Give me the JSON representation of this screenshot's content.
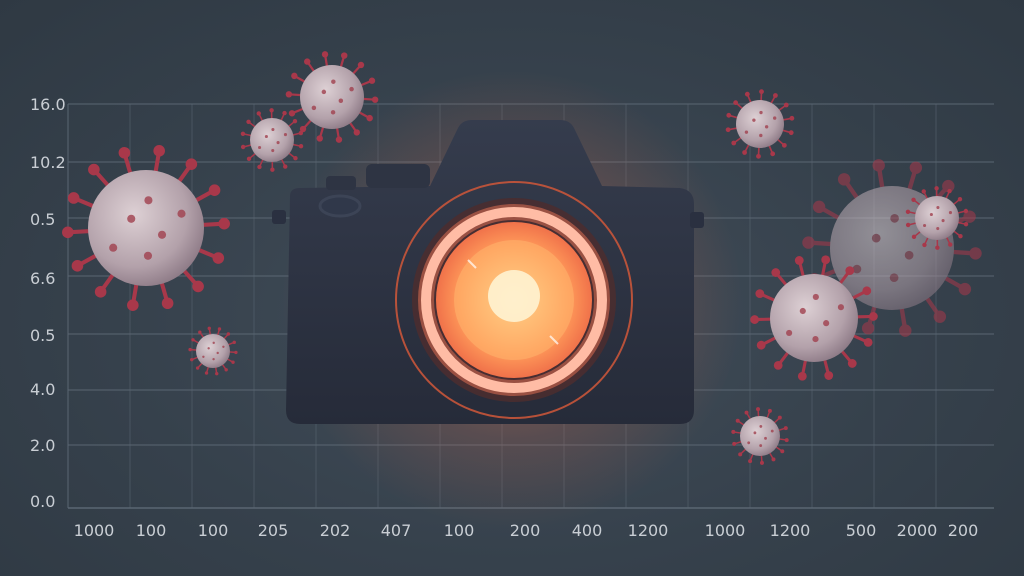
{
  "palette": {
    "background": "#36414c",
    "grid": "#5a6672",
    "axis_text": "#c9ced4",
    "camera_body": "#2a3040",
    "lens_glow": "#ff8a4c",
    "virus_body": "#b9a8b0",
    "virus_spike": "#a8384a"
  },
  "y_axis": {
    "tick_labels": [
      "16.0",
      "10.2",
      "0.5",
      "6.6",
      "0.5",
      "4.0",
      "2.0",
      "0.0"
    ]
  },
  "x_axis": {
    "tick_labels": [
      "1000",
      "100",
      "100",
      "205",
      "202",
      "407",
      "100",
      "200",
      "400",
      "1200",
      "1000",
      "1200",
      "500",
      "2000",
      "200"
    ]
  },
  "illustration": {
    "subject": "camera-icon",
    "particles": "virus-icon"
  }
}
